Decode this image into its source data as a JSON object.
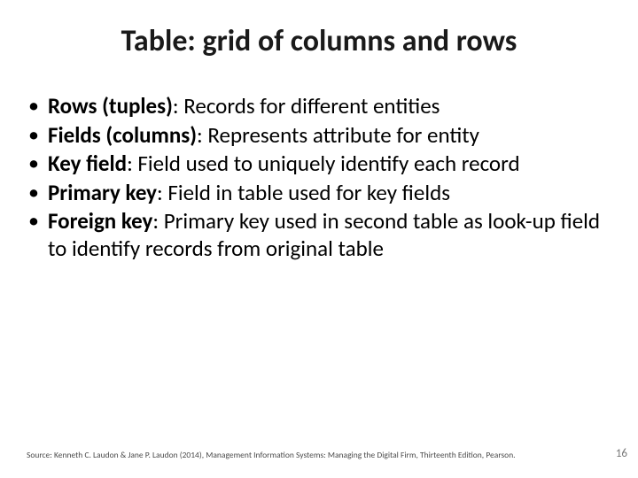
{
  "title": "Table: grid of columns and rows",
  "bullets": [
    {
      "term": "Rows (tuples)",
      "desc": ": Records for different entities"
    },
    {
      "term": "Fields (columns)",
      "desc": ": Represents attribute for entity"
    },
    {
      "term": "Key field",
      "desc": ": Field used to uniquely identify each record"
    },
    {
      "term": "Primary key",
      "desc": ": Field in table used for key fields"
    },
    {
      "term": "Foreign key",
      "desc": ": Primary key used in second table as look-up field to identify records from original table"
    }
  ],
  "source": "Source: Kenneth C. Laudon & Jane P. Laudon (2014), Management Information Systems: Managing the Digital Firm, Thirteenth Edition, Pearson.",
  "page_number": "16"
}
